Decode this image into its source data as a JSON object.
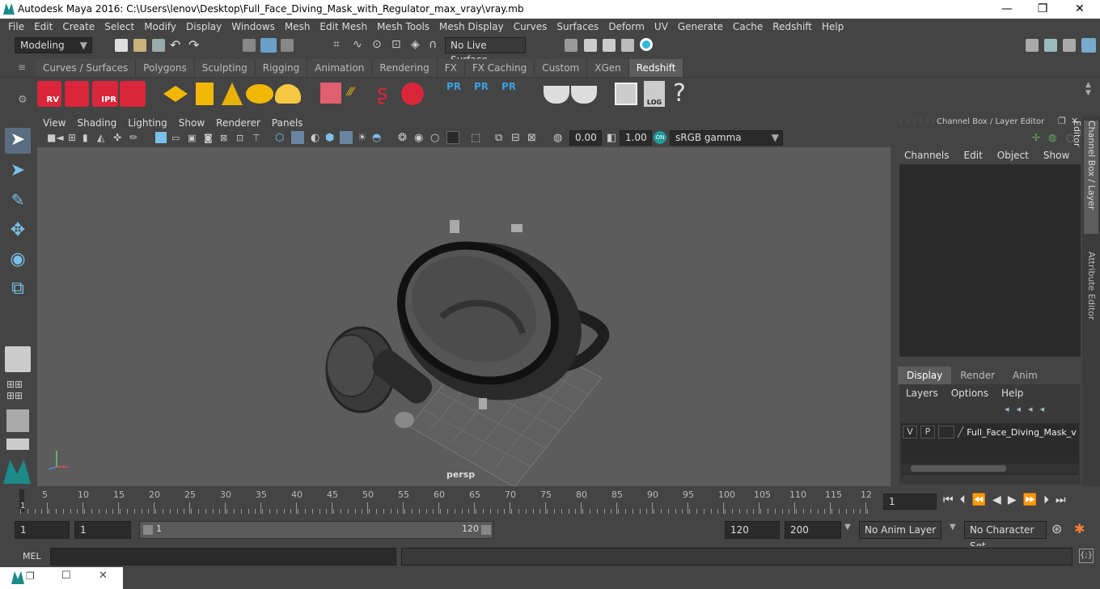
{
  "window": {
    "title": "Autodesk Maya 2016: C:\\Users\\lenov\\Desktop\\Full_Face_Diving_Mask_with_Regulator_max_vray\\vray.mb",
    "minimize": "—",
    "maximize": "❐",
    "close": "✕"
  },
  "menu": [
    "File",
    "Edit",
    "Create",
    "Select",
    "Modify",
    "Display",
    "Windows",
    "Mesh",
    "Edit Mesh",
    "Mesh Tools",
    "Mesh Display",
    "Curves",
    "Surfaces",
    "Deform",
    "UV",
    "Generate",
    "Cache",
    "Redshift",
    "Help"
  ],
  "status": {
    "mode": "Modeling",
    "live_surface": "No Live Surface"
  },
  "shelf_tabs": [
    "Curves / Surfaces",
    "Polygons",
    "Sculpting",
    "Rigging",
    "Animation",
    "Rendering",
    "FX",
    "FX Caching",
    "Custom",
    "XGen",
    "Redshift"
  ],
  "shelf_active": "Redshift",
  "shelf_icons": {
    "rv": "RV",
    "ipr": "IPR",
    "pr1": "PR",
    "pr2": "PR",
    "pr3": "PR",
    "log": "LOG",
    "help": "?"
  },
  "panel_menu": [
    "View",
    "Shading",
    "Lighting",
    "Show",
    "Renderer",
    "Panels"
  ],
  "viewport": {
    "exposure": "0.00",
    "gamma": "1.00",
    "color_space": "sRGB gamma",
    "camera": "persp"
  },
  "channel_box": {
    "title": "Channel Box / Layer Editor",
    "menu": [
      "Channels",
      "Edit",
      "Object",
      "Show"
    ],
    "layer_tabs": [
      "Display",
      "Render",
      "Anim"
    ],
    "layer_menu": [
      "Layers",
      "Options",
      "Help"
    ],
    "layer": {
      "v": "V",
      "p": "P",
      "name": "Full_Face_Diving_Mask_v"
    }
  },
  "side_tabs": {
    "channel": "Channel Box / Layer Editor",
    "attribute": "Attribute Editor"
  },
  "timeline": {
    "ticks": [
      "5",
      "10",
      "15",
      "20",
      "25",
      "30",
      "35",
      "40",
      "45",
      "50",
      "55",
      "60",
      "65",
      "70",
      "75",
      "80",
      "85",
      "90",
      "95",
      "100",
      "105",
      "110",
      "115",
      "12"
    ],
    "current_frame_label": "1",
    "current_frame": "1"
  },
  "range": {
    "start": "1",
    "playback_start": "1",
    "slider_start": "1",
    "slider_end": "120",
    "playback_end": "120",
    "end": "200",
    "anim_layer": "No Anim Layer",
    "character_set": "No Character Set"
  },
  "mel": {
    "label": "MEL"
  },
  "colors": {
    "accent": "#5d5d5d",
    "redshift_red": "#d9263b",
    "pr_blue": "#3a9fe0",
    "viewport_bg": "#5c5c5c"
  }
}
